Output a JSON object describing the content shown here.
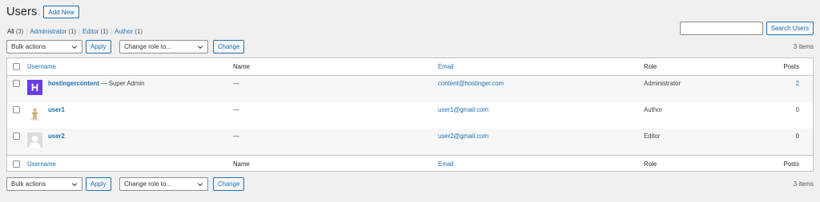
{
  "header": {
    "title": "Users",
    "add_new_label": "Add New"
  },
  "filters": [
    {
      "label": "All",
      "count": "(3)",
      "current": true
    },
    {
      "label": "Administrator",
      "count": "(1)",
      "current": false
    },
    {
      "label": "Editor",
      "count": "(1)",
      "current": false
    },
    {
      "label": "Author",
      "count": "(1)",
      "current": false
    }
  ],
  "search": {
    "value": "",
    "button_label": "Search Users"
  },
  "tablenav": {
    "bulk_actions": "Bulk actions",
    "apply_label": "Apply",
    "change_role": "Change role to...",
    "change_label": "Change",
    "items_count": "3 items"
  },
  "columns": {
    "username": "Username",
    "name": "Name",
    "email": "Email",
    "role": "Role",
    "posts": "Posts"
  },
  "users": [
    {
      "username": "hostingercontent",
      "note": " — Super Admin",
      "name": "—",
      "email": "content@hostinger.com",
      "role": "Administrator",
      "posts": "2",
      "avatar": "hostinger-logo-avatar"
    },
    {
      "username": "user1",
      "note": "",
      "name": "—",
      "email": "user1@gmail.com",
      "role": "Author",
      "posts": "0",
      "avatar": "person-figure-avatar"
    },
    {
      "username": "user2",
      "note": "",
      "name": "—",
      "email": "user2@gmail.com",
      "role": "Editor",
      "posts": "0",
      "avatar": "default-person-avatar"
    }
  ],
  "colors": {
    "link": "#2271b1",
    "background": "#f0f0f1",
    "border": "#c3c4c7",
    "stripe": "#f6f7f7",
    "hostinger_purple": "#673de6"
  }
}
